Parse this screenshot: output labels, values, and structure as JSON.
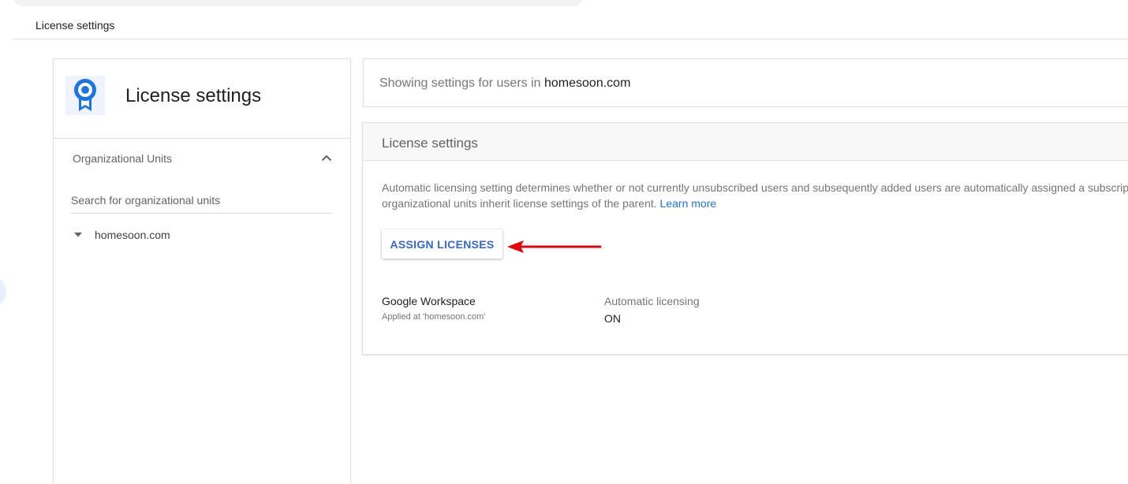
{
  "breadcrumb": "License settings",
  "side_panel": {
    "title": "License settings",
    "icon": "license-badge-icon",
    "ou_section_title": "Organizational Units",
    "ou_search_placeholder": "Search for organizational units",
    "ou_tree": [
      {
        "label": "homesoon.com",
        "expanded": true
      }
    ]
  },
  "settings_for": {
    "prefix": "Showing settings for users in ",
    "domain": "homesoon.com"
  },
  "card": {
    "title": "License settings",
    "description_line1": "Automatic licensing setting determines whether or not currently unsubscribed users and subsequently added users are automatically assigned a subscrip",
    "description_line2": "organizational units inherit license settings of the parent. ",
    "learn_more": "Learn more",
    "assign_button": "ASSIGN LICENSES",
    "product": {
      "name": "Google Workspace",
      "applied_at": "Applied at 'homesoon.com'",
      "setting_label": "Automatic licensing",
      "setting_value": "ON"
    }
  },
  "colors": {
    "accent": "#1a73e8",
    "button_text": "#3367d6",
    "arrow": "#e8000b"
  }
}
